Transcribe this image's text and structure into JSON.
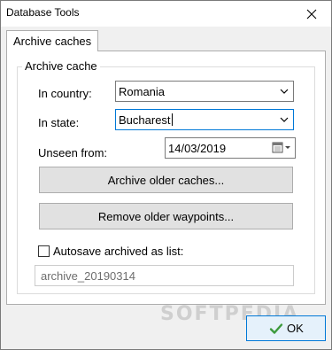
{
  "window": {
    "title": "Database Tools"
  },
  "tabs": [
    {
      "label": "Archive caches",
      "active": true
    }
  ],
  "archive_cache": {
    "group_title": "Archive cache",
    "country_label": "In country:",
    "country_value": "Romania",
    "state_label": "In state:",
    "state_value": "Bucharest",
    "unseen_label": "Unseen from:",
    "unseen_date": "14/03/2019",
    "archive_button": "Archive older caches...",
    "remove_button": "Remove older waypoints...",
    "autosave_label": "Autosave archived as list:",
    "autosave_checked": false,
    "list_name_value": "archive_20190314"
  },
  "footer": {
    "ok_label": "OK",
    "watermark": "SOFTPEDIA"
  },
  "colors": {
    "accent": "#0078d7",
    "ok_check": "#3c9a3c"
  },
  "icons": {
    "close": "close-icon",
    "dropdown": "chevron-down-icon",
    "calendar": "calendar-icon",
    "ok": "check-icon"
  }
}
